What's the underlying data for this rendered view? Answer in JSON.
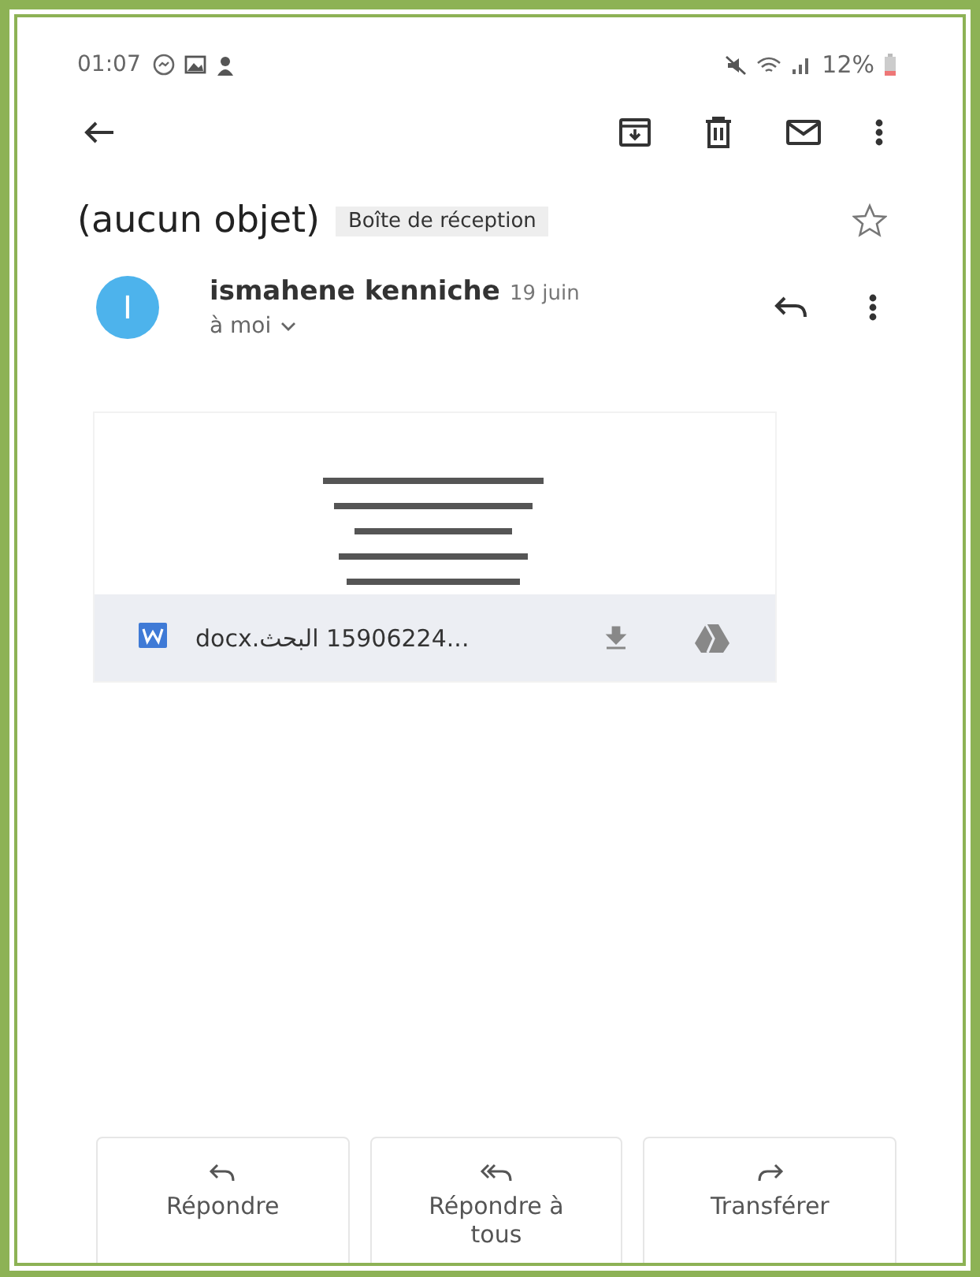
{
  "status_bar": {
    "time": "01:07",
    "battery": "12%"
  },
  "subject": {
    "title": "(aucun objet)",
    "label": "Boîte de réception",
    "starred": false
  },
  "message": {
    "avatar_letter": "I",
    "sender": "ismahene kenniche",
    "date": "19 juin",
    "recipient": "à moi"
  },
  "attachment": {
    "file_name": "...15906224 البحث.docx"
  },
  "actions": [
    {
      "kind": "reply",
      "label": "Répondre"
    },
    {
      "kind": "reply_all",
      "label": "Répondre à tous"
    },
    {
      "kind": "forward",
      "label": "Transférer"
    }
  ]
}
